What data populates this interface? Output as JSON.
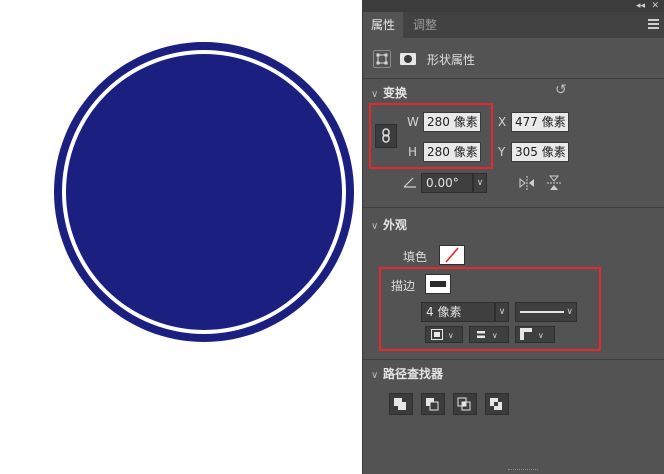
{
  "canvas": {
    "shape": "circle",
    "fill_color": "#1b1f80",
    "ring_color": "#ffffff"
  },
  "panel": {
    "tabs": [
      "属性",
      "调整"
    ],
    "active_tab": "属性",
    "header_label": "形状属性",
    "transform": {
      "title": "变换",
      "w_label": "W",
      "w_value": "280 像素",
      "h_label": "H",
      "h_value": "280 像素",
      "x_label": "X",
      "x_value": "477 像素",
      "y_label": "Y",
      "y_value": "305 像素",
      "angle_value": "0.00°"
    },
    "appearance": {
      "title": "外观",
      "fill_label": "填色",
      "stroke_label": "描边",
      "stroke_width": "4 像素"
    },
    "pathfinder": {
      "title": "路径查找器"
    },
    "colors": {
      "highlight": "#e4282c",
      "panel_bg": "#535353"
    }
  }
}
